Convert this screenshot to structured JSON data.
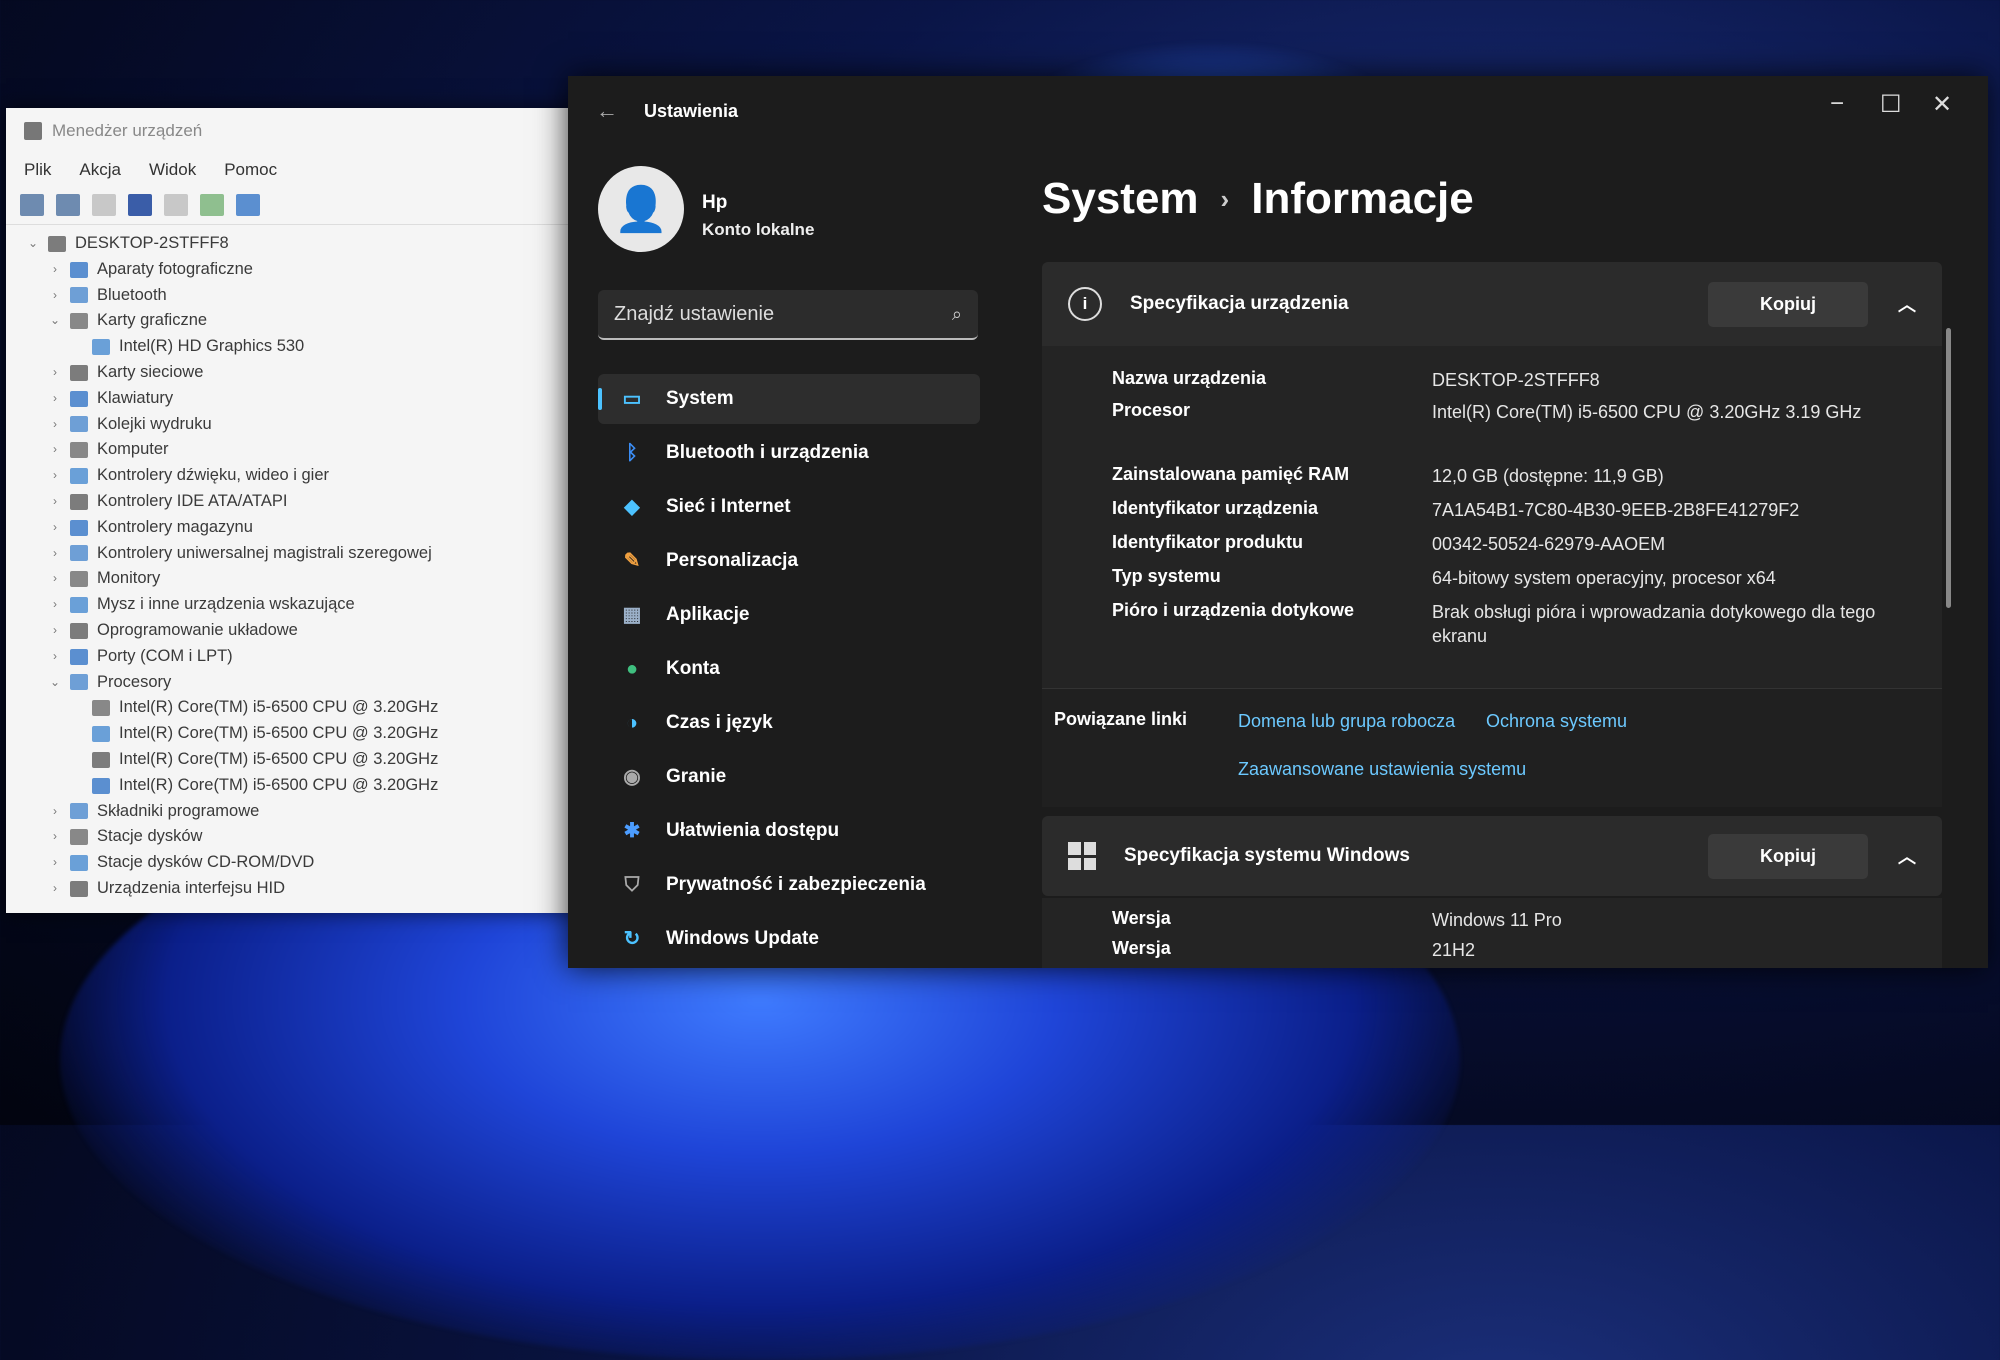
{
  "device_manager": {
    "title": "Menedżer urządzeń",
    "menu": [
      "Plik",
      "Akcja",
      "Widok",
      "Pomoc"
    ],
    "tree": [
      {
        "label": "DESKTOP-2STFFF8",
        "level": 0,
        "expanded": true
      },
      {
        "label": "Aparaty fotograficzne",
        "level": 1,
        "expanded": false
      },
      {
        "label": "Bluetooth",
        "level": 1,
        "expanded": false
      },
      {
        "label": "Karty graficzne",
        "level": 1,
        "expanded": true
      },
      {
        "label": "Intel(R) HD Graphics 530",
        "level": 2
      },
      {
        "label": "Karty sieciowe",
        "level": 1,
        "expanded": false
      },
      {
        "label": "Klawiatury",
        "level": 1,
        "expanded": false
      },
      {
        "label": "Kolejki wydruku",
        "level": 1,
        "expanded": false
      },
      {
        "label": "Komputer",
        "level": 1,
        "expanded": false
      },
      {
        "label": "Kontrolery dźwięku, wideo i gier",
        "level": 1,
        "expanded": false
      },
      {
        "label": "Kontrolery IDE ATA/ATAPI",
        "level": 1,
        "expanded": false
      },
      {
        "label": "Kontrolery magazynu",
        "level": 1,
        "expanded": false
      },
      {
        "label": "Kontrolery uniwersalnej magistrali szeregowej",
        "level": 1,
        "expanded": false
      },
      {
        "label": "Monitory",
        "level": 1,
        "expanded": false
      },
      {
        "label": "Mysz i inne urządzenia wskazujące",
        "level": 1,
        "expanded": false
      },
      {
        "label": "Oprogramowanie układowe",
        "level": 1,
        "expanded": false
      },
      {
        "label": "Porty (COM i LPT)",
        "level": 1,
        "expanded": false
      },
      {
        "label": "Procesory",
        "level": 1,
        "expanded": true
      },
      {
        "label": "Intel(R) Core(TM) i5-6500 CPU @ 3.20GHz",
        "level": 2
      },
      {
        "label": "Intel(R) Core(TM) i5-6500 CPU @ 3.20GHz",
        "level": 2
      },
      {
        "label": "Intel(R) Core(TM) i5-6500 CPU @ 3.20GHz",
        "level": 2
      },
      {
        "label": "Intel(R) Core(TM) i5-6500 CPU @ 3.20GHz",
        "level": 2
      },
      {
        "label": "Składniki programowe",
        "level": 1,
        "expanded": false
      },
      {
        "label": "Stacje dysków",
        "level": 1,
        "expanded": false
      },
      {
        "label": "Stacje dysków CD-ROM/DVD",
        "level": 1,
        "expanded": false
      },
      {
        "label": "Urządzenia interfejsu HID",
        "level": 1,
        "expanded": false
      }
    ]
  },
  "settings": {
    "title": "Ustawienia",
    "user": {
      "name": "Hp",
      "account": "Konto lokalne"
    },
    "search": {
      "placeholder": "Znajdź ustawienie"
    },
    "nav": [
      {
        "label": "System",
        "icon": "monitor-icon",
        "active": true,
        "color": "#4cc2ff"
      },
      {
        "label": "Bluetooth i urządzenia",
        "icon": "bluetooth-icon",
        "color": "#3b8df5"
      },
      {
        "label": "Sieć i Internet",
        "icon": "wifi-icon",
        "color": "#4cc2ff"
      },
      {
        "label": "Personalizacja",
        "icon": "brush-icon",
        "color": "#f0a040"
      },
      {
        "label": "Aplikacje",
        "icon": "apps-icon",
        "color": "#9bb0c8"
      },
      {
        "label": "Konta",
        "icon": "person-icon",
        "color": "#3fbf7f"
      },
      {
        "label": "Czas i język",
        "icon": "globe-clock-icon",
        "color": "#4cc2ff"
      },
      {
        "label": "Granie",
        "icon": "gamepad-icon",
        "color": "#aaaaaa"
      },
      {
        "label": "Ułatwienia dostępu",
        "icon": "accessibility-icon",
        "color": "#4c9dff"
      },
      {
        "label": "Prywatność i zabezpieczenia",
        "icon": "shield-icon",
        "color": "#aaaaaa"
      },
      {
        "label": "Windows Update",
        "icon": "update-icon",
        "color": "#4cc2ff"
      }
    ],
    "breadcrumb": {
      "parent": "System",
      "separator": "›",
      "current": "Informacje"
    },
    "device_specs": {
      "header": "Specyfikacja urządzenia",
      "copy_label": "Kopiuj",
      "rows": [
        {
          "key": "Nazwa urządzenia",
          "value": "DESKTOP-2STFFF8"
        },
        {
          "key": "Procesor",
          "value": "Intel(R) Core(TM) i5-6500 CPU @ 3.20GHz   3.19 GHz"
        },
        {
          "key": "Zainstalowana pamięć RAM",
          "value": "12,0 GB (dostępne: 11,9 GB)"
        },
        {
          "key": "Identyfikator urządzenia",
          "value": "7A1A54B1-7C80-4B30-9EEB-2B8FE41279F2"
        },
        {
          "key": "Identyfikator produktu",
          "value": "00342-50524-62979-AAOEM"
        },
        {
          "key": "Typ systemu",
          "value": "64-bitowy system operacyjny, procesor x64"
        },
        {
          "key": "Pióro i urządzenia dotykowe",
          "value": "Brak obsługi pióra i wprowadzania dotykowego dla tego ekranu"
        }
      ]
    },
    "related_links": {
      "label": "Powiązane linki",
      "links": [
        "Domena lub grupa robocza",
        "Ochrona systemu",
        "Zaawansowane ustawienia systemu"
      ]
    },
    "windows_specs": {
      "header": "Specyfikacja systemu Windows",
      "copy_label": "Kopiuj",
      "rows": [
        {
          "key": "Wersja",
          "value": "Windows 11 Pro"
        },
        {
          "key": "Wersja",
          "value": "21H2"
        }
      ]
    }
  }
}
